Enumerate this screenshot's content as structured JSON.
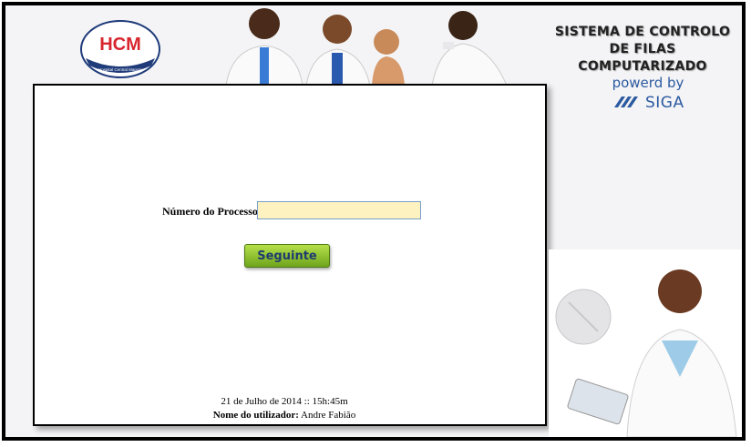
{
  "header": {
    "logo_text": "HCM",
    "logo_subtext": "Hospital Central Maputo",
    "title_line1": "SISTEMA DE CONTROLO",
    "title_line2": "DE FILAS COMPUTARIZADO",
    "powered_by": "powerd by",
    "brand": "SIGA"
  },
  "form": {
    "process_number_label": "Número do Processo:",
    "process_number_value": "",
    "next_button_label": "Seguinte"
  },
  "footer": {
    "datetime": "21 de Julho  de 2014 ::  15h:45m",
    "user_label": "Nome do utilizador:",
    "user_name": "Andre Fabião"
  },
  "colors": {
    "input_bg": "#fdf2c0",
    "button_green": "#8cc43a",
    "brand_blue": "#2c5aa0",
    "logo_red": "#d7262e",
    "logo_navy": "#1f3b7a"
  }
}
